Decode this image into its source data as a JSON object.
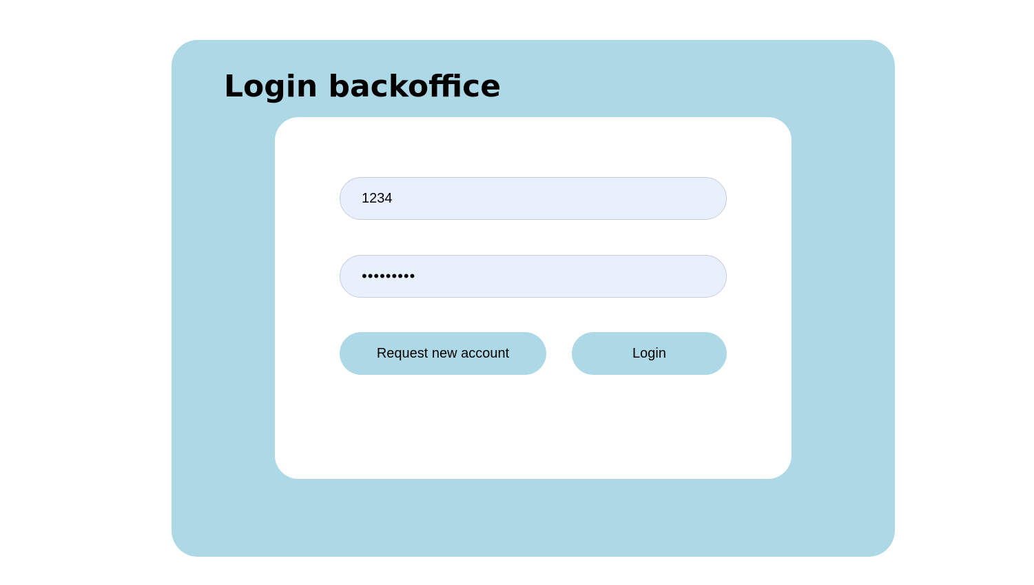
{
  "page": {
    "title": "Login backoffice"
  },
  "form": {
    "username_value": "1234",
    "password_value": "123456789",
    "request_account_label": "Request new account",
    "login_label": "Login"
  },
  "colors": {
    "panel_background": "#add8e6",
    "card_background": "#ffffff",
    "input_background": "#e8f0fe",
    "button_background": "#add8e6"
  }
}
